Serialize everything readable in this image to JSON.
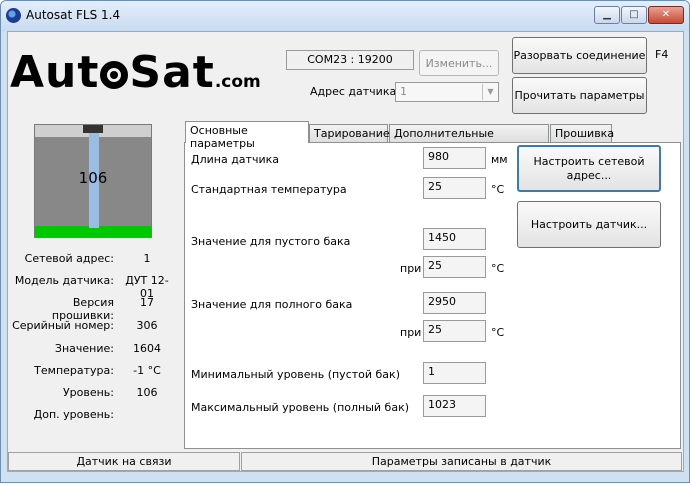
{
  "window": {
    "title": "Autosat FLS 1.4",
    "controls": {
      "minimize": "▁",
      "maximize": "□",
      "close": "✕"
    }
  },
  "logo": {
    "part1": "Aut",
    "part2": "Sat",
    "part3": ".com"
  },
  "connection": {
    "port": "COM23 : 19200",
    "change_label": "Изменить...",
    "address_label": "Адрес датчика:",
    "address_value": "1",
    "disconnect_label": "Разорвать соединение",
    "hotkey": "F4",
    "read_label": "Прочитать параметры"
  },
  "gauge": {
    "level_text": "106",
    "level_fraction": 0.1
  },
  "info": [
    {
      "label": "Сетевой адрес:",
      "value": "1"
    },
    {
      "label": "Модель датчика:",
      "value": "ДУТ 12-01"
    },
    {
      "label": "Версия прошивки:",
      "value": "17"
    },
    {
      "label": "Серийный номер:",
      "value": "306"
    },
    {
      "label": "Значение:",
      "value": "1604"
    },
    {
      "label": "Температура:",
      "value": "-1 °C"
    },
    {
      "label": "Уровень:",
      "value": "106"
    },
    {
      "label": "Доп. уровень:",
      "value": ""
    }
  ],
  "tabs": [
    "Основные параметры",
    "Тарирование",
    "Дополнительные параметры",
    "Прошивка"
  ],
  "params": {
    "length_label": "Длина датчика",
    "length_value": "980",
    "length_unit": "мм",
    "temp_label": "Стандартная температура",
    "temp_value": "25",
    "temp_unit": "°C",
    "empty_label": "Значение для пустого бака",
    "empty_value": "1450",
    "empty_at_label": "при",
    "empty_temp": "25",
    "empty_temp_unit": "°C",
    "full_label": "Значение для полного бака",
    "full_value": "2950",
    "full_at_label": "при",
    "full_temp": "25",
    "full_temp_unit": "°C",
    "min_label": "Минимальный уровень (пустой бак)",
    "min_value": "1",
    "max_label": "Максимальный уровень (полный бак)",
    "max_value": "1023"
  },
  "actions": {
    "network_setup": "Настроить сетевой адрес...",
    "sensor_setup": "Настроить датчик..."
  },
  "status": {
    "left": "Датчик на связи",
    "right": "Параметры записаны в датчик"
  }
}
